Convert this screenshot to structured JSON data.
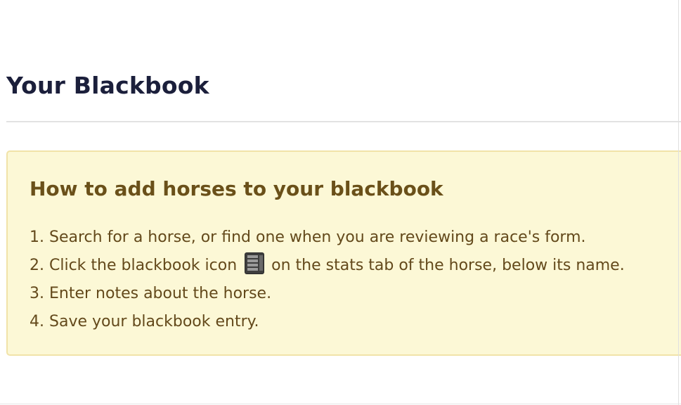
{
  "page": {
    "title": "Your Blackbook"
  },
  "info_box": {
    "heading": "How to add horses to your blackbook",
    "steps": [
      {
        "number": "1.",
        "text": "Search for a horse, or find one when you are reviewing a race's form."
      },
      {
        "number": "2.",
        "text_before": "Click the blackbook icon",
        "icon": "blackbook-icon",
        "text_after": "on the stats tab of the horse, below its name."
      },
      {
        "number": "3.",
        "text": "Enter notes about the horse."
      },
      {
        "number": "4.",
        "text": "Save your blackbook entry."
      }
    ]
  },
  "colors": {
    "title": "#1b1f3b",
    "box_background": "#fcf8d6",
    "box_border": "#f1e3a8",
    "box_text": "#63491b",
    "divider": "#e2e2e2"
  }
}
